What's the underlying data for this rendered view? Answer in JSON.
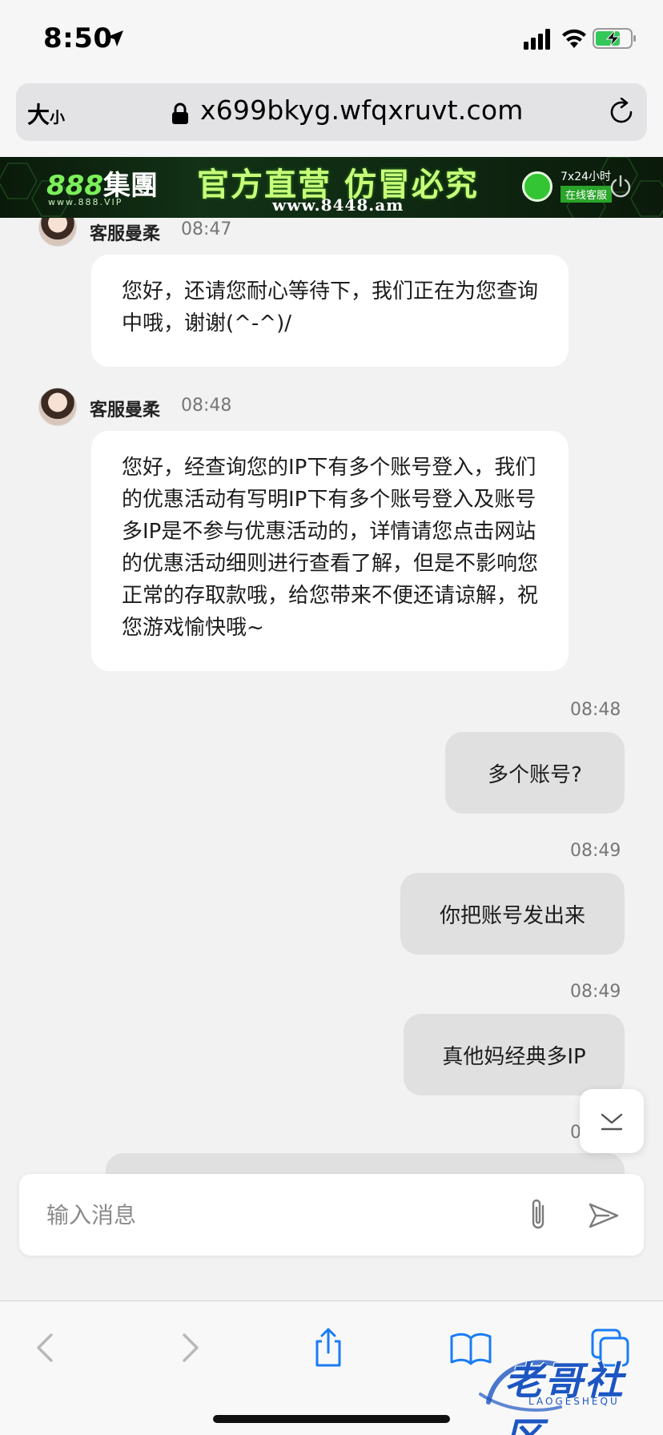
{
  "status_bar": {
    "time": "8:50",
    "icons": [
      "location-arrow-icon",
      "cellular-signal-icon",
      "wifi-icon",
      "battery-charging-icon"
    ]
  },
  "browser": {
    "text_size_label": "大",
    "text_size_label_small": "小",
    "url": "x699bkyg.wfqxruvt.com",
    "icons": [
      "lock-icon",
      "reload-icon"
    ]
  },
  "banner": {
    "logo_number": "888",
    "logo_text": "集團",
    "logo_sub": "www.888.VIP",
    "headline": "官方直营 仿冒必究",
    "site": "www.8448.am",
    "cs_line1": "7x24小时",
    "cs_line2": "在线客服"
  },
  "chat": {
    "messages": [
      {
        "sender": "客服曼柔",
        "time": "08:47",
        "direction": "in",
        "text": "您好，还请您耐心等待下，我们正在为您查询中哦，谢谢(^-^)/"
      },
      {
        "sender": "客服曼柔",
        "time": "08:48",
        "direction": "in",
        "text": "您好，经查询您的IP下有多个账号登入，我们的优惠活动有写明IP下有多个账号登入及账号多IP是不参与优惠活动的，详情请您点击网站的优惠活动细则进行查看了解，但是不影响您正常的存取款哦，给您带来不便还请谅解，祝您游戏愉快哦~"
      },
      {
        "time": "08:48",
        "direction": "out",
        "text": "多个账号?"
      },
      {
        "time": "08:49",
        "direction": "out",
        "text": "你把账号发出来"
      },
      {
        "time": "08:49",
        "direction": "out",
        "text": "真他妈经典多IP"
      },
      {
        "time": "0",
        "direction": "out",
        "text": ""
      }
    ]
  },
  "composer": {
    "placeholder": "输入消息",
    "icons": [
      "attach-icon",
      "send-icon"
    ]
  },
  "toolbar": {
    "icons": [
      "back-icon",
      "forward-icon",
      "share-icon",
      "bookmarks-icon",
      "tabs-icon"
    ]
  },
  "watermark": {
    "text": "老哥社区",
    "sub": "LAOGESHEQU"
  }
}
